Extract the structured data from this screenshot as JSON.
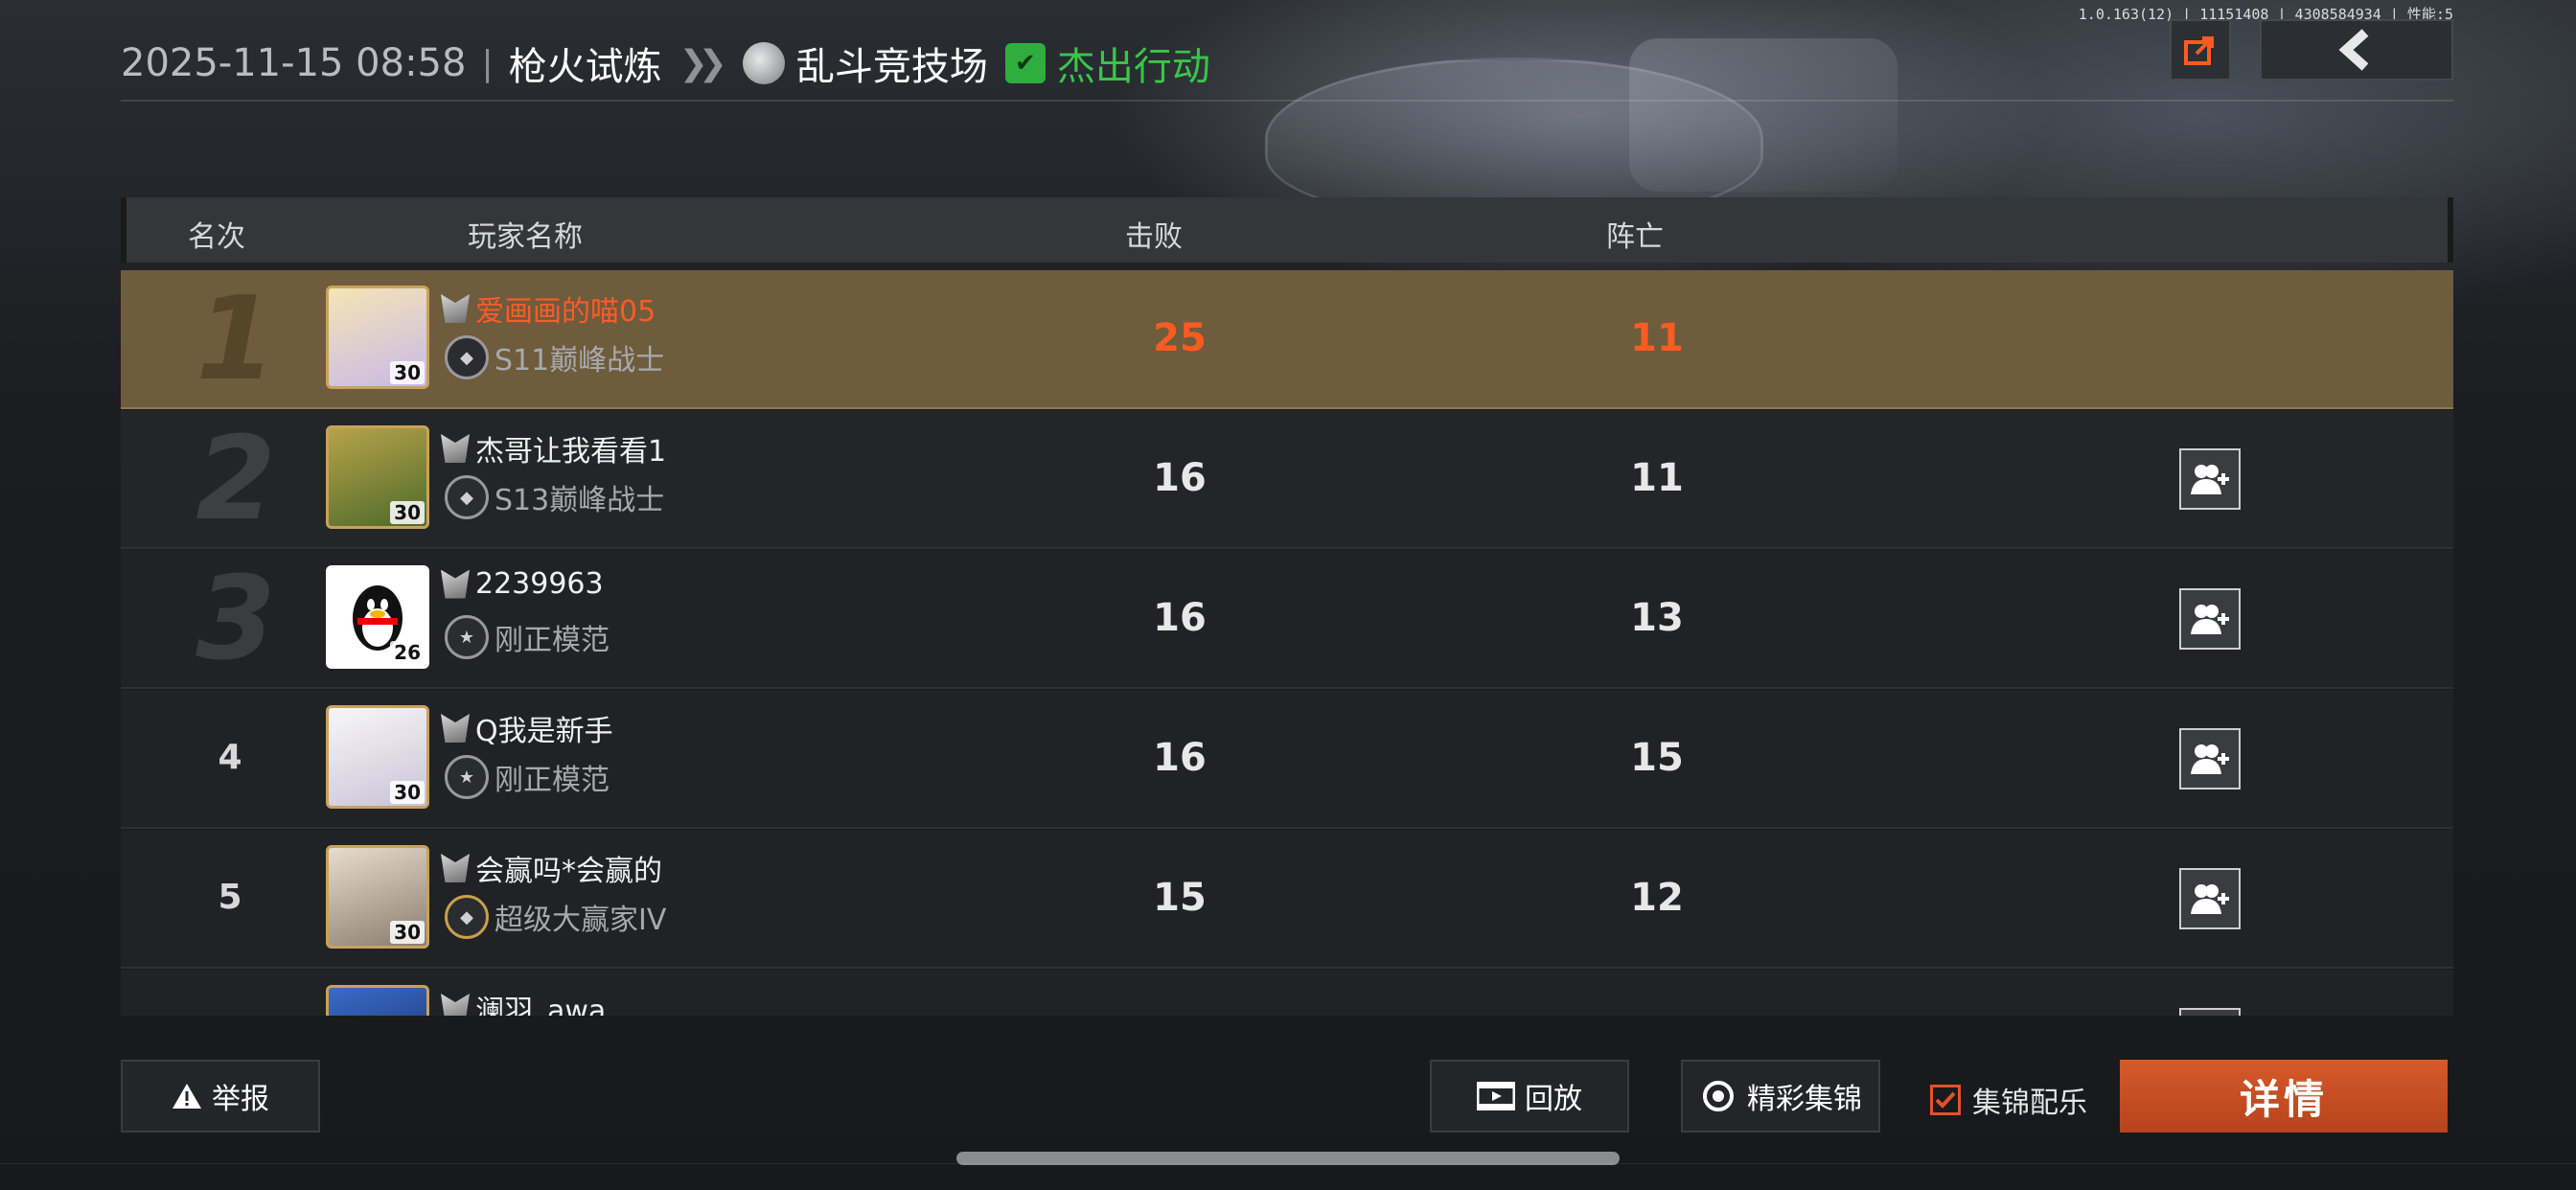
{
  "header": {
    "datetime": "2025-11-15 08:58",
    "separator": "|",
    "mode": "枪火试炼",
    "arena": "乱斗竞技场",
    "badge": "杰出行动",
    "build_info": "1.0.163(12) | 11151408 | 4308584934 | 性能:5"
  },
  "table": {
    "columns": {
      "rank": "名次",
      "player": "玩家名称",
      "kills": "击败",
      "deaths": "阵亡"
    },
    "rows": [
      {
        "rank": "1",
        "name": "爱画画的喵05",
        "title": "S11巅峰战士",
        "level": "30",
        "kills": "25",
        "deaths": "11",
        "highlight": true
      },
      {
        "rank": "2",
        "name": "杰哥让我看看1",
        "title": "S13巅峰战士",
        "level": "30",
        "kills": "16",
        "deaths": "11"
      },
      {
        "rank": "3",
        "name": "2239963",
        "title": "刚正模范",
        "level": "26",
        "kills": "16",
        "deaths": "13"
      },
      {
        "rank": "4",
        "name": "Q我是新手",
        "title": "刚正模范",
        "level": "30",
        "kills": "16",
        "deaths": "15"
      },
      {
        "rank": "5",
        "name": "会赢吗*会赢的",
        "title": "超级大赢家IV",
        "level": "30",
        "kills": "15",
        "deaths": "12"
      },
      {
        "rank": "",
        "name": "澜羽_awa",
        "title": "",
        "level": "",
        "kills": "",
        "deaths": ""
      }
    ]
  },
  "footer": {
    "report": "举报",
    "replay": "回放",
    "highlights": "精彩集锦",
    "music": "集锦配乐",
    "details": "详情"
  },
  "colors": {
    "accent": "#d65a2a",
    "highlight_row": "#6e5c3c",
    "green": "#39c64a"
  }
}
